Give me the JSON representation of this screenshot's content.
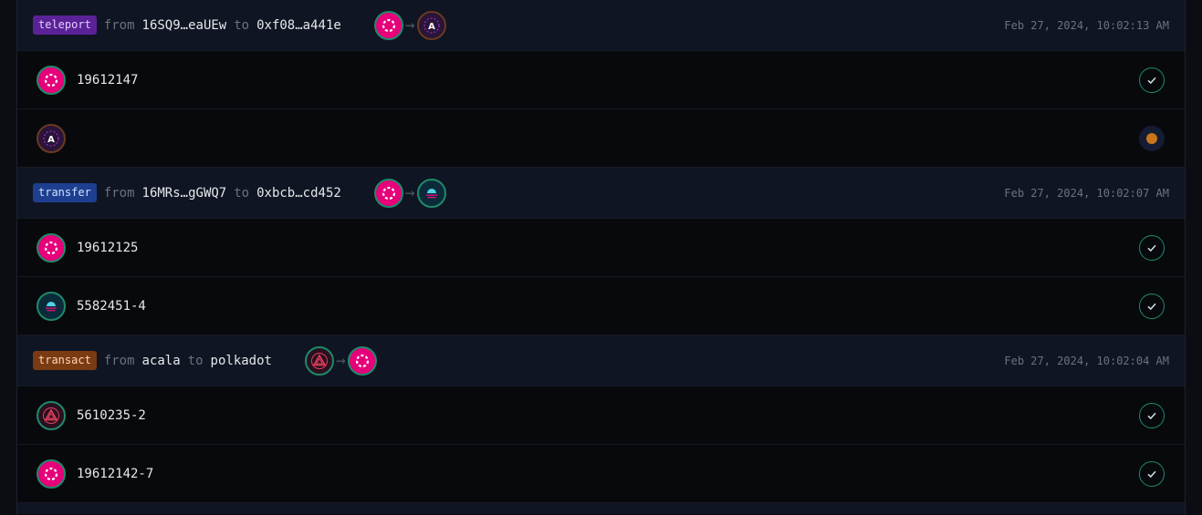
{
  "groups": [
    {
      "type": "teleport",
      "from_label": "from",
      "from": "16SQ9…eaUEw",
      "to_label": "to",
      "to": "0xf08…a441e",
      "route": [
        "polkadot",
        "astar"
      ],
      "timestamp": "Feb 27, 2024, 10:02:13 AM",
      "rows": [
        {
          "chain": "polkadot",
          "value": "19612147",
          "status": "success"
        },
        {
          "chain": "astar",
          "value": "",
          "status": "pending"
        }
      ]
    },
    {
      "type": "transfer",
      "from_label": "from",
      "from": "16MRs…gGWQ7",
      "to_label": "to",
      "to": "0xbcb…cd452",
      "route": [
        "polkadot",
        "moonbeam"
      ],
      "timestamp": "Feb 27, 2024, 10:02:07 AM",
      "rows": [
        {
          "chain": "polkadot",
          "value": "19612125",
          "status": "success"
        },
        {
          "chain": "moonbeam",
          "value": "5582451-4",
          "status": "success"
        }
      ]
    },
    {
      "type": "transact",
      "from_label": "from",
      "from": "acala",
      "to_label": "to",
      "to": "polkadot",
      "route": [
        "acala",
        "polkadot"
      ],
      "timestamp": "Feb 27, 2024, 10:02:04 AM",
      "rows": [
        {
          "chain": "acala",
          "value": "5610235-2",
          "status": "success"
        },
        {
          "chain": "polkadot",
          "value": "19612142-7",
          "status": "success"
        }
      ]
    }
  ],
  "colors": {
    "success": "#1f8a6a",
    "pending": "#c9751c",
    "polkadot": "#e6007a"
  }
}
